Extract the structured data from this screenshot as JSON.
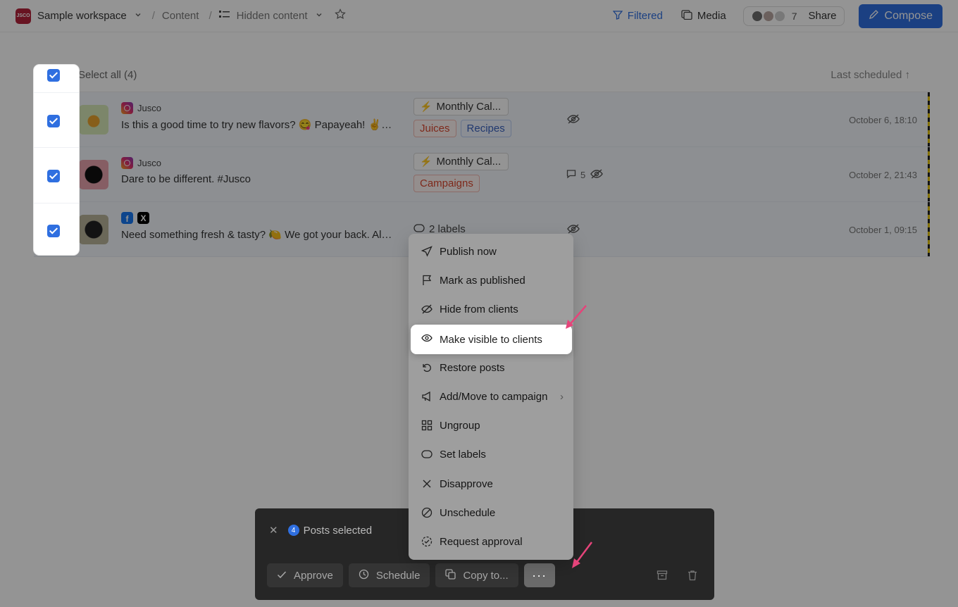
{
  "header": {
    "workspace_logo": "JSCO",
    "workspace_name": "Sample workspace",
    "breadcrumb_content": "Content",
    "view_name": "Hidden content",
    "filtered_label": "Filtered",
    "media_label": "Media",
    "member_count": "7",
    "share_label": "Share",
    "compose_label": "Compose"
  },
  "table": {
    "select_all_label": "Select all (4)",
    "sort_label": "Last scheduled",
    "rows": [
      {
        "account": "Jusco",
        "text": "Is this a good time to try new flavors? 😋 Papayeah! ✌️…",
        "campaign": "Monthly Cal...",
        "labels": [
          "Juices",
          "Recipes"
        ],
        "comments": "",
        "date": "October 6, 18:10"
      },
      {
        "account": "Jusco",
        "text": "Dare to be different. #Jusco",
        "campaign": "Monthly Cal...",
        "labels": [
          "Campaigns"
        ],
        "comments": "5",
        "date": "October 2, 21:43"
      },
      {
        "account": "",
        "text": "Need something fresh & tasty? 🍋 We got your back. Al…",
        "labels_summary": "2 labels",
        "date": "October 1, 09:15"
      }
    ]
  },
  "menu": {
    "items": [
      {
        "label": "Publish now",
        "icon": "send-icon"
      },
      {
        "label": "Mark as published",
        "icon": "flag-icon"
      },
      {
        "label": "Hide from clients",
        "icon": "eye-off-icon"
      },
      {
        "label": "Make visible to clients",
        "icon": "eye-icon"
      },
      {
        "label": "Restore posts",
        "icon": "restore-icon"
      },
      {
        "label": "Add/Move to campaign",
        "icon": "megaphone-icon"
      },
      {
        "label": "Ungroup",
        "icon": "grid-icon"
      },
      {
        "label": "Set labels",
        "icon": "label-icon"
      },
      {
        "label": "Disapprove",
        "icon": "x-icon"
      },
      {
        "label": "Unschedule",
        "icon": "unschedule-icon"
      },
      {
        "label": "Request approval",
        "icon": "request-approval-icon"
      }
    ]
  },
  "action_bar": {
    "selected_count": "4",
    "selected_label": "Posts selected",
    "approve_label": "Approve",
    "schedule_label": "Schedule",
    "copy_label": "Copy to...",
    "more_label": "···"
  },
  "colors": {
    "accent": "#2f6fe0",
    "arrow": "#e5447a",
    "campaign_red": "#d9482f"
  }
}
